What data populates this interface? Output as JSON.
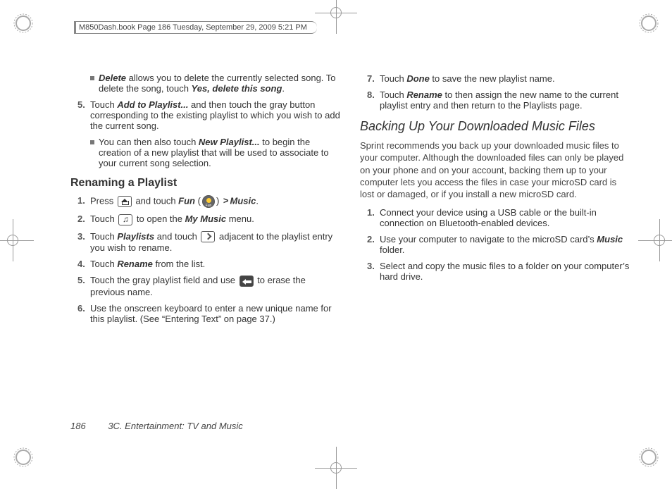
{
  "header": "M850Dash.book  Page 186  Tuesday, September 29, 2009  5:21 PM",
  "footer": {
    "page": "186",
    "section": "3C. Entertainment: TV and Music"
  },
  "left": {
    "bullet1_pre": "",
    "bullet1_delete": "Delete",
    "bullet1_mid": " allows you to delete the currently selected song. To delete the song, touch ",
    "bullet1_yes": "Yes, delete this song",
    "bullet1_end": ".",
    "step5_n": "5.",
    "step5_pre": "Touch ",
    "step5_add": "Add to Playlist...",
    "step5_post": " and then touch the gray button corresponding to the existing playlist to which you wish to add the current song.",
    "bullet2_pre": "You can then also touch ",
    "bullet2_np": "New Playlist...",
    "bullet2_post": " to begin the creation of a new playlist that will be used to associate to your current song selection.",
    "h_rename": "Renaming a Playlist",
    "r1_n": "1.",
    "r1_pre": "Press ",
    "r1_mid": " and touch ",
    "r1_fun": "Fun",
    "r1_paren_open": " (",
    "r1_paren_close": ") ",
    "r1_music": "Music",
    "r1_end": ".",
    "r2_n": "2.",
    "r2_pre": "Touch ",
    "r2_mid": " to open the ",
    "r2_mm": "My Music",
    "r2_end": " menu.",
    "r3_n": "3.",
    "r3_pre": "Touch ",
    "r3_pl": "Playlists",
    "r3_mid": " and touch ",
    "r3_post": " adjacent to the playlist entry you wish to rename.",
    "r4_n": "4.",
    "r4_pre": "Touch ",
    "r4_ren": "Rename",
    "r4_post": " from the list.",
    "r5_n": "5.",
    "r5_pre": "Touch the gray playlist field and use ",
    "r5_post": " to erase the previous name.",
    "r6_n": "6.",
    "r6_text": "Use the onscreen keyboard to enter a new unique name for this playlist. (See “Entering Text” on page 37.)"
  },
  "right": {
    "s7_n": "7.",
    "s7_pre": "Touch ",
    "s7_done": "Done",
    "s7_post": " to save the new playlist name.",
    "s8_n": "8.",
    "s8_pre": "Touch ",
    "s8_ren": "Rename",
    "s8_post": " to then assign the new name to the current playlist entry and then return to the Playlists page.",
    "h_backup": "Backing Up Your Downloaded Music Files",
    "intro": "Sprint recommends you back up your downloaded music files to your computer. Although the downloaded files can only be played on your phone and on your account, backing them up to your computer lets you access the files in case your microSD card is lost or damaged, or if you install a new microSD card.",
    "b1_n": "1.",
    "b1_text": "Connect your device using a USB cable or the built-in connection on Bluetooth-enabled devices.",
    "b2_n": "2.",
    "b2_pre": "Use your computer to navigate to the microSD card’s ",
    "b2_music": "Music",
    "b2_post": " folder.",
    "b3_n": "3.",
    "b3_text": "Select and copy the music files to a folder on your computer’s hard drive."
  }
}
